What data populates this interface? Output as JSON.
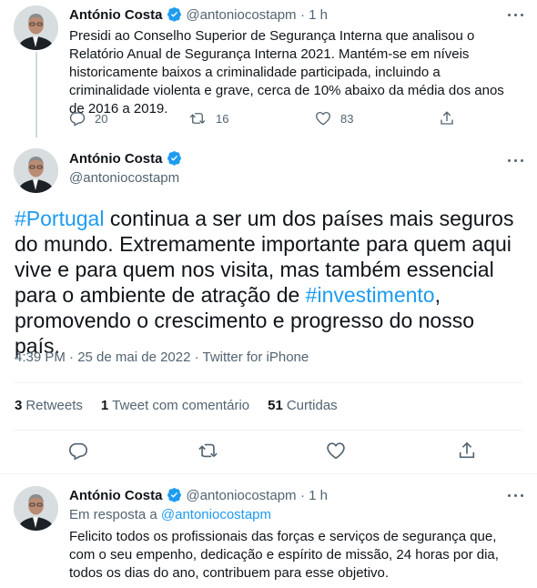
{
  "tweet1": {
    "name": "António Costa",
    "handle": "@antoniocostapm",
    "time": "· 1 h",
    "text": "Presidi ao Conselho Superior de Segurança Interna que analisou o Relatório Anual de Segurança Interna 2021. Mantém-se em níveis historicamente baixos a criminalidade participada, incluindo a criminalidade violenta e grave, cerca de 10% abaixo da média dos anos de 2016 a 2019.",
    "replies": "20",
    "retweets": "16",
    "likes": "83"
  },
  "main_tweet": {
    "name": "António Costa",
    "handle": "@antoniocostapm",
    "hashtag1": "#Portugal",
    "text_part1": " continua a ser um dos países mais seguros do mundo. Extremamente importante para quem aqui vive e para quem nos visita, mas também essencial para o ambiente de atração de ",
    "hashtag2": "#investimento",
    "text_part2": ", promovendo o crescimento e progresso do nosso país.",
    "meta": "4:39 PM · 25 de mai de 2022 · Twitter for iPhone",
    "retweets_count": "3",
    "retweets_label": "Retweets",
    "quotes_count": "1",
    "quotes_label": "Tweet com comentário",
    "likes_count": "51",
    "likes_label": "Curtidas"
  },
  "tweet3": {
    "name": "António Costa",
    "handle": "@antoniocostapm",
    "time": "· 1 h",
    "reply_prefix": "Em resposta a ",
    "reply_handle": "@antoniocostapm",
    "text": "Felicito todos os profissionais das forças e serviços de segurança que, com o seu empenho, dedicação e espírito de missão, 24 horas por dia, todos os dias do ano, contribuem para esse objetivo."
  },
  "icons": [
    "reply-icon",
    "retweet-icon",
    "like-icon",
    "share-icon",
    "verified-icon",
    "more-icon"
  ],
  "colors": {
    "accent": "#1d9bf0",
    "text": "#0f1419",
    "secondary": "#536471",
    "border": "#eff3f4"
  }
}
